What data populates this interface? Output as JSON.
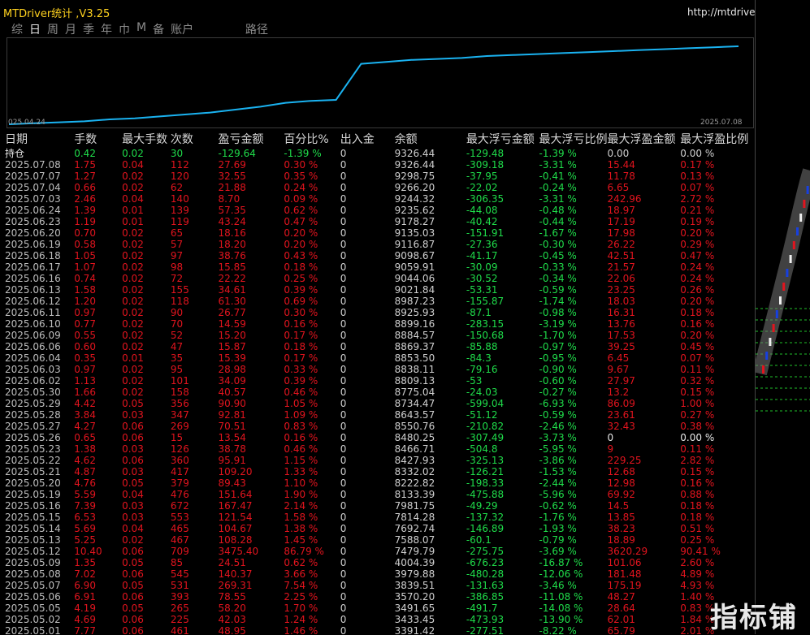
{
  "window": {
    "title": "MTDriver统计 ,V3.25",
    "url": "http://mtdriver.cn"
  },
  "tabs": [
    "综",
    "日",
    "周",
    "月",
    "季",
    "年",
    "巾",
    "M",
    "备",
    "账户"
  ],
  "active_tab": "日",
  "curve_tab": "路径",
  "chart": {
    "start_date": "025.04.24",
    "end_date": "2025.07.08",
    "line_color": "#1ab2f0",
    "equity_curve": [
      0,
      1,
      2,
      3,
      5,
      6,
      8,
      10,
      12,
      15,
      18,
      22,
      24,
      25,
      62,
      64,
      66,
      67,
      68,
      70,
      71,
      72,
      73,
      74,
      75,
      76,
      77,
      78,
      79,
      80
    ]
  },
  "headers": [
    "日期",
    "手数",
    "最大手数",
    "次数",
    "盈亏金额",
    "百分比%",
    "出入金",
    "余额",
    "最大浮亏金额",
    "最大浮亏比例",
    "最大浮盈金额",
    "最大浮盈比例"
  ],
  "holding": [
    "持仓",
    "0.42",
    "0.02",
    "30",
    "-129.64",
    "-1.39 %",
    "0",
    "9326.44",
    "-129.48",
    "-1.39 %",
    "0.00",
    "0.00 %"
  ],
  "rows": [
    [
      "2025.07.08",
      "1.75",
      "0.04",
      "112",
      "27.69",
      "0.30 %",
      "0",
      "9326.44",
      "-309.18",
      "-3.31 %",
      "15.44",
      "0.17 %"
    ],
    [
      "2025.07.07",
      "1.27",
      "0.02",
      "120",
      "32.55",
      "0.35 %",
      "0",
      "9298.75",
      "-37.95",
      "-0.41 %",
      "11.78",
      "0.13 %"
    ],
    [
      "2025.07.04",
      "0.66",
      "0.02",
      "62",
      "21.88",
      "0.24 %",
      "0",
      "9266.20",
      "-22.02",
      "-0.24 %",
      "6.65",
      "0.07 %"
    ],
    [
      "2025.07.03",
      "2.46",
      "0.04",
      "140",
      "8.70",
      "0.09 %",
      "0",
      "9244.32",
      "-306.35",
      "-3.31 %",
      "242.96",
      "2.72 %"
    ],
    [
      "2025.06.24",
      "1.39",
      "0.01",
      "139",
      "57.35",
      "0.62 %",
      "0",
      "9235.62",
      "-44.08",
      "-0.48 %",
      "18.97",
      "0.21 %"
    ],
    [
      "2025.06.23",
      "1.19",
      "0.01",
      "119",
      "43.24",
      "0.47 %",
      "0",
      "9178.27",
      "-40.42",
      "-0.44 %",
      "17.19",
      "0.19 %"
    ],
    [
      "2025.06.20",
      "0.70",
      "0.02",
      "65",
      "18.16",
      "0.20 %",
      "0",
      "9135.03",
      "-151.91",
      "-1.67 %",
      "17.98",
      "0.20 %"
    ],
    [
      "2025.06.19",
      "0.58",
      "0.02",
      "57",
      "18.20",
      "0.20 %",
      "0",
      "9116.87",
      "-27.36",
      "-0.30 %",
      "26.22",
      "0.29 %"
    ],
    [
      "2025.06.18",
      "1.05",
      "0.02",
      "97",
      "38.76",
      "0.43 %",
      "0",
      "9098.67",
      "-41.17",
      "-0.45 %",
      "42.51",
      "0.47 %"
    ],
    [
      "2025.06.17",
      "1.07",
      "0.02",
      "98",
      "15.85",
      "0.18 %",
      "0",
      "9059.91",
      "-30.09",
      "-0.33 %",
      "21.57",
      "0.24 %"
    ],
    [
      "2025.06.16",
      "0.74",
      "0.02",
      "72",
      "22.22",
      "0.25 %",
      "0",
      "9044.06",
      "-30.52",
      "-0.34 %",
      "22.06",
      "0.24 %"
    ],
    [
      "2025.06.13",
      "1.58",
      "0.02",
      "155",
      "34.61",
      "0.39 %",
      "0",
      "9021.84",
      "-53.31",
      "-0.59 %",
      "23.25",
      "0.26 %"
    ],
    [
      "2025.06.12",
      "1.20",
      "0.02",
      "118",
      "61.30",
      "0.69 %",
      "0",
      "8987.23",
      "-155.87",
      "-1.74 %",
      "18.03",
      "0.20 %"
    ],
    [
      "2025.06.11",
      "0.97",
      "0.02",
      "90",
      "26.77",
      "0.30 %",
      "0",
      "8925.93",
      "-87.1",
      "-0.98 %",
      "16.31",
      "0.18 %"
    ],
    [
      "2025.06.10",
      "0.77",
      "0.02",
      "70",
      "14.59",
      "0.16 %",
      "0",
      "8899.16",
      "-283.15",
      "-3.19 %",
      "13.76",
      "0.16 %"
    ],
    [
      "2025.06.09",
      "0.55",
      "0.02",
      "52",
      "15.20",
      "0.17 %",
      "0",
      "8884.57",
      "-150.68",
      "-1.70 %",
      "17.53",
      "0.20 %"
    ],
    [
      "2025.06.06",
      "0.60",
      "0.02",
      "47",
      "15.87",
      "0.18 %",
      "0",
      "8869.37",
      "-85.88",
      "-0.97 %",
      "39.25",
      "0.45 %"
    ],
    [
      "2025.06.04",
      "0.35",
      "0.01",
      "35",
      "15.39",
      "0.17 %",
      "0",
      "8853.50",
      "-84.3",
      "-0.95 %",
      "6.45",
      "0.07 %"
    ],
    [
      "2025.06.03",
      "0.97",
      "0.02",
      "95",
      "28.98",
      "0.33 %",
      "0",
      "8838.11",
      "-79.16",
      "-0.90 %",
      "9.67",
      "0.11 %"
    ],
    [
      "2025.06.02",
      "1.13",
      "0.02",
      "101",
      "34.09",
      "0.39 %",
      "0",
      "8809.13",
      "-53",
      "-0.60 %",
      "27.97",
      "0.32 %"
    ],
    [
      "2025.05.30",
      "1.66",
      "0.02",
      "158",
      "40.57",
      "0.46 %",
      "0",
      "8775.04",
      "-24.03",
      "-0.27 %",
      "13.2",
      "0.15 %"
    ],
    [
      "2025.05.29",
      "4.42",
      "0.05",
      "356",
      "90.90",
      "1.05 %",
      "0",
      "8734.47",
      "-599.04",
      "-6.93 %",
      "86.09",
      "1.00 %"
    ],
    [
      "2025.05.28",
      "3.84",
      "0.03",
      "347",
      "92.81",
      "1.09 %",
      "0",
      "8643.57",
      "-51.12",
      "-0.59 %",
      "23.61",
      "0.27 %"
    ],
    [
      "2025.05.27",
      "4.27",
      "0.06",
      "269",
      "70.51",
      "0.83 %",
      "0",
      "8550.76",
      "-210.82",
      "-2.46 %",
      "32.43",
      "0.38 %"
    ],
    [
      "2025.05.26",
      "0.65",
      "0.06",
      "15",
      "13.54",
      "0.16 %",
      "0",
      "8480.25",
      "-307.49",
      "-3.73 %",
      "0",
      "0.00 %"
    ],
    [
      "2025.05.23",
      "1.38",
      "0.03",
      "126",
      "38.78",
      "0.46 %",
      "0",
      "8466.71",
      "-504.8",
      "-5.95 %",
      "9",
      "0.11 %"
    ],
    [
      "2025.05.22",
      "4.62",
      "0.06",
      "360",
      "95.91",
      "1.15 %",
      "0",
      "8427.93",
      "-325.13",
      "-3.86 %",
      "229.25",
      "2.82 %"
    ],
    [
      "2025.05.21",
      "4.87",
      "0.03",
      "417",
      "109.20",
      "1.33 %",
      "0",
      "8332.02",
      "-126.21",
      "-1.53 %",
      "12.68",
      "0.15 %"
    ],
    [
      "2025.05.20",
      "4.76",
      "0.05",
      "379",
      "89.43",
      "1.10 %",
      "0",
      "8222.82",
      "-198.33",
      "-2.44 %",
      "12.98",
      "0.16 %"
    ],
    [
      "2025.05.19",
      "5.59",
      "0.04",
      "476",
      "151.64",
      "1.90 %",
      "0",
      "8133.39",
      "-475.88",
      "-5.96 %",
      "69.92",
      "0.88 %"
    ],
    [
      "2025.05.16",
      "7.39",
      "0.03",
      "672",
      "167.47",
      "2.14 %",
      "0",
      "7981.75",
      "-49.29",
      "-0.62 %",
      "14.5",
      "0.18 %"
    ],
    [
      "2025.05.15",
      "6.53",
      "0.03",
      "553",
      "121.54",
      "1.58 %",
      "0",
      "7814.28",
      "-137.32",
      "-1.76 %",
      "13.85",
      "0.18 %"
    ],
    [
      "2025.05.14",
      "5.69",
      "0.04",
      "465",
      "104.67",
      "1.38 %",
      "0",
      "7692.74",
      "-146.89",
      "-1.93 %",
      "38.23",
      "0.51 %"
    ],
    [
      "2025.05.13",
      "5.25",
      "0.02",
      "467",
      "108.28",
      "1.45 %",
      "0",
      "7588.07",
      "-60.1",
      "-0.79 %",
      "18.89",
      "0.25 %"
    ],
    [
      "2025.05.12",
      "10.40",
      "0.06",
      "709",
      "3475.40",
      "86.79 %",
      "0",
      "7479.79",
      "-275.75",
      "-3.69 %",
      "3620.29",
      "90.41 %"
    ],
    [
      "2025.05.09",
      "1.35",
      "0.05",
      "85",
      "24.51",
      "0.62 %",
      "0",
      "4004.39",
      "-676.23",
      "-16.87 %",
      "101.06",
      "2.60 %"
    ],
    [
      "2025.05.08",
      "7.02",
      "0.06",
      "545",
      "140.37",
      "3.66 %",
      "0",
      "3979.88",
      "-480.28",
      "-12.06 %",
      "181.48",
      "4.89 %"
    ],
    [
      "2025.05.07",
      "6.90",
      "0.05",
      "531",
      "269.31",
      "7.54 %",
      "0",
      "3839.51",
      "-131.63",
      "-3.46 %",
      "175.19",
      "4.93 %"
    ],
    [
      "2025.05.06",
      "6.91",
      "0.06",
      "393",
      "78.55",
      "2.25 %",
      "0",
      "3570.20",
      "-386.85",
      "-11.08 %",
      "48.27",
      "1.40 %"
    ],
    [
      "2025.05.05",
      "4.19",
      "0.05",
      "265",
      "58.20",
      "1.70 %",
      "0",
      "3491.65",
      "-491.7",
      "-14.08 %",
      "28.64",
      "0.83 %"
    ],
    [
      "2025.05.02",
      "4.69",
      "0.06",
      "225",
      "42.03",
      "1.24 %",
      "0",
      "3433.45",
      "-473.93",
      "-13.90 %",
      "62.01",
      "1.84 %"
    ],
    [
      "2025.05.01",
      "7.77",
      "0.06",
      "461",
      "48.95",
      "1.46 %",
      "0",
      "3391.42",
      "-277.51",
      "-8.22 %",
      "65.79",
      "2.01 %"
    ]
  ],
  "watermark": "指标铺"
}
